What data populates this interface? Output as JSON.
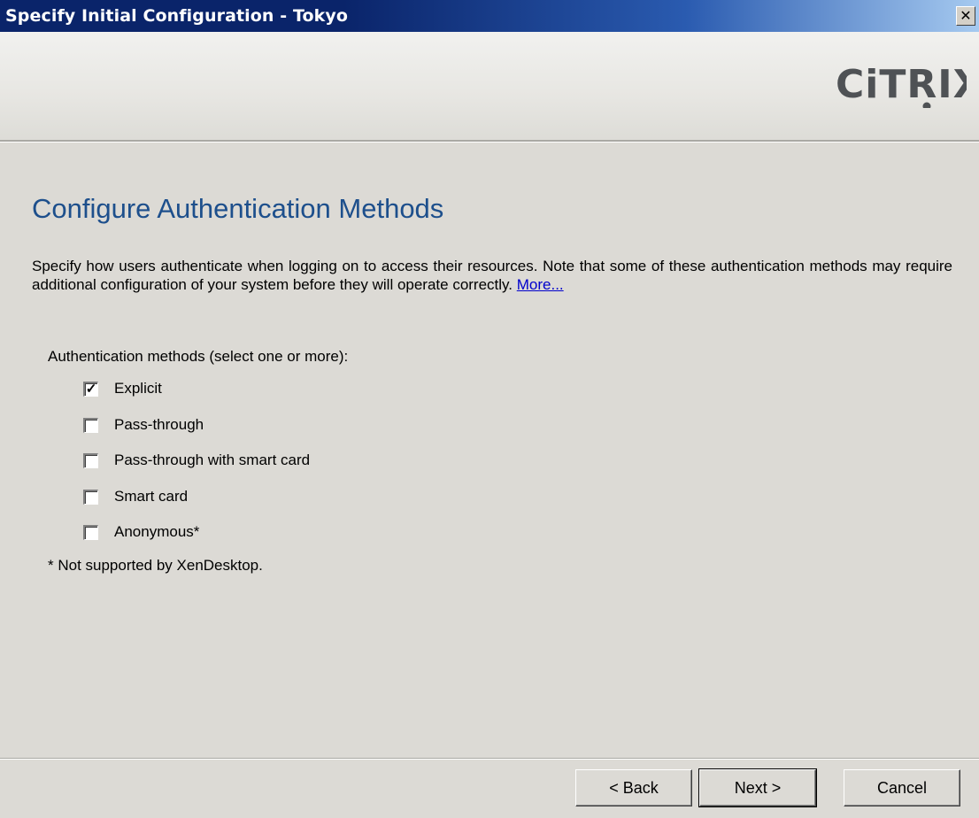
{
  "window": {
    "title": "Specify Initial Configuration - Tokyo",
    "close_glyph": "✕"
  },
  "header": {
    "logo_text": "CiTRIX",
    "logo_color": "#4f5255"
  },
  "main": {
    "title": "Configure Authentication Methods",
    "description": "Specify how users authenticate when logging on to access their resources. Note that some of these authentication methods may require additional configuration of your system before they will operate correctly.",
    "more_link": "More...",
    "group_label": "Authentication methods (select one or more):",
    "methods": [
      {
        "label": "Explicit",
        "checked": true
      },
      {
        "label": "Pass-through",
        "checked": false
      },
      {
        "label": "Pass-through with smart card",
        "checked": false
      },
      {
        "label": "Smart card",
        "checked": false
      },
      {
        "label": "Anonymous*",
        "checked": false
      }
    ],
    "footnote": "* Not supported by XenDesktop."
  },
  "buttons": {
    "back": "< Back",
    "next": "Next >",
    "cancel": "Cancel"
  },
  "colors": {
    "title_bar": "#0a246a",
    "heading": "#1d4f8c",
    "link": "#0000cc"
  }
}
